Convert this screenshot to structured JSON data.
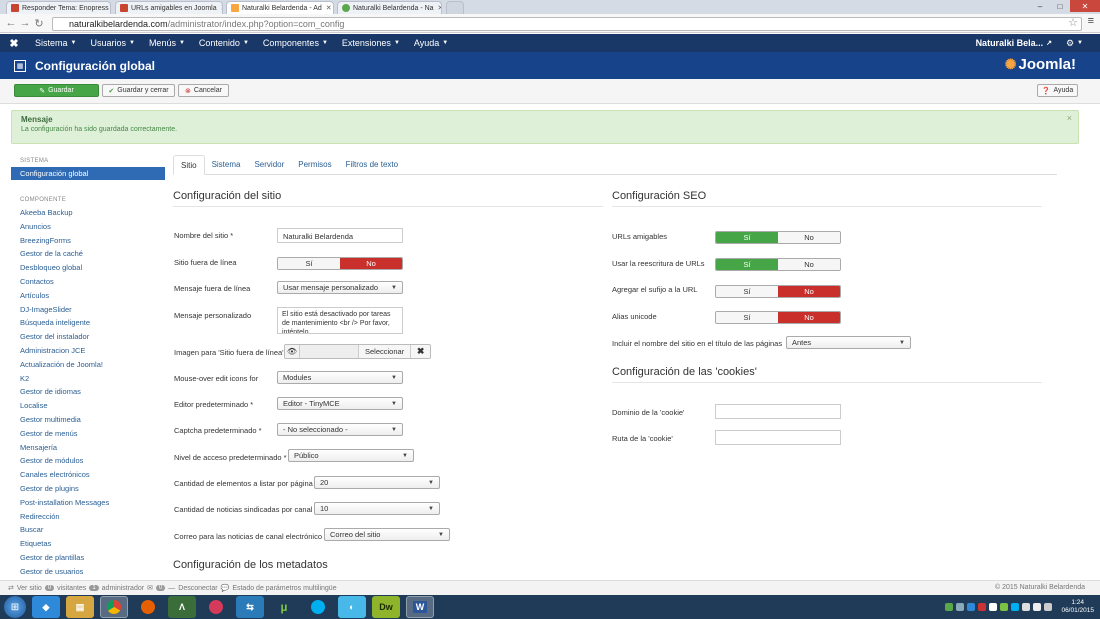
{
  "browser": {
    "tabs": [
      {
        "label": "Responder Tema: Enopress",
        "favicon_color": "#c8452f",
        "active": false
      },
      {
        "label": "URLs amigables en Joomla",
        "favicon_color": "#c8452f",
        "active": false
      },
      {
        "label": "Naturalki Belardenda - Ad",
        "favicon_color": "#f9a541",
        "active": true
      },
      {
        "label": "Naturalki Belardenda - Na",
        "favicon_color": "#5aa84a",
        "active": false
      }
    ],
    "url_host": "naturalkibelardenda.com",
    "url_path": "/administrator/index.php?option=com_config",
    "back_icon": "back-arrow-icon",
    "forward_icon": "forward-arrow-icon",
    "reload_icon": "reload-icon"
  },
  "nav": {
    "menu": [
      {
        "label": "Sistema"
      },
      {
        "label": "Usuarios"
      },
      {
        "label": "Menús"
      },
      {
        "label": "Contenido"
      },
      {
        "label": "Componentes"
      },
      {
        "label": "Extensiones"
      },
      {
        "label": "Ayuda"
      }
    ],
    "user_label": "Naturalki Bela...",
    "bg_color": "#1a3867"
  },
  "header": {
    "title": "Configuración global",
    "brand": "Joomla!",
    "bg_color": "#17438a"
  },
  "toolbar": {
    "save": "Guardar",
    "save_close": "Guardar y cerrar",
    "cancel": "Cancelar",
    "help": "Ayuda"
  },
  "message": {
    "heading": "Mensaje",
    "body": "La configuración ha sido guardada correctamente."
  },
  "sidebar": {
    "system_heading": "SISTEMA",
    "active_item": "Configuración global",
    "component_heading": "COMPONENTE",
    "items": [
      "Akeeba Backup",
      "Anuncios",
      "BreezingForms",
      "Gestor de la caché",
      "Desbloqueo global",
      "Contactos",
      "Artículos",
      "DJ-ImageSlider",
      "Búsqueda inteligente",
      "Gestor del instalador",
      "Administracion JCE",
      "Actualización de Joomla!",
      "K2",
      "Gestor de idiomas",
      "Localise",
      "Gestor multimedia",
      "Gestor de menús",
      "Mensajería",
      "Gestor de módulos",
      "Canales electrónicos",
      "Gestor de plugins",
      "Post-installation Messages",
      "Redirección",
      "Buscar",
      "Etiquetas",
      "Gestor de plantillas",
      "Gestor de usuarios"
    ]
  },
  "tabs": [
    "Sitio",
    "Sistema",
    "Servidor",
    "Permisos",
    "Filtros de texto"
  ],
  "site": {
    "title": "Configuración del sitio",
    "site_name_label": "Nombre del sitio *",
    "site_name_value": "Naturalki Belardenda",
    "offline_label": "Sitio fuera de línea",
    "offline_yes": "Sí",
    "offline_no": "No",
    "offline_msg_label": "Mensaje fuera de línea",
    "offline_msg_value": "Usar mensaje personalizado",
    "custom_msg_label": "Mensaje personalizado",
    "custom_msg_value": "El sitio está desactivado por tareas de mantenimiento <br /> Por favor, inténtelo",
    "offline_image_label": "Imagen para 'Sitio fuera de línea'",
    "select_label": "Seleccionar",
    "mouseover_label": "Mouse-over edit icons for",
    "mouseover_value": "Modules",
    "editor_label": "Editor predeterminado *",
    "editor_value": "Editor - TinyMCE",
    "captcha_label": "Captcha predeterminado *",
    "captcha_value": "- No seleccionado -",
    "access_label": "Nivel de acceso predeterminado *",
    "access_value": "Público",
    "list_limit_label": "Cantidad de elementos a listar por página",
    "list_limit_value": "20",
    "feed_limit_label": "Cantidad de noticias sindicadas por canal",
    "feed_limit_value": "10",
    "feed_email_label": "Correo para las noticias de canal electrónico",
    "feed_email_value": "Correo del sitio",
    "metadata_title": "Configuración de los metadatos"
  },
  "seo": {
    "title": "Configuración SEO",
    "sef_label": "URLs amigables",
    "rewrite_label": "Usar la reescritura de URLs",
    "suffix_label": "Agregar el sufijo a la URL",
    "unicode_label": "Alias unicode",
    "yes": "Sí",
    "no": "No",
    "sitename_label": "Incluir el nombre del sitio en el título de las páginas",
    "sitename_value": "Antes"
  },
  "cookies": {
    "title": "Configuración de las 'cookies'",
    "domain_label": "Dominio de la 'cookie'",
    "path_label": "Ruta de la 'cookie'"
  },
  "statusbar": {
    "view_site": "Ver sitio",
    "visitors_count": "0",
    "visitors_label": "visitantes",
    "admin_count": "1",
    "admin_label": "administrador",
    "messages_count": "0",
    "logout": "Desconectar",
    "multilang": "Estado de parámetros multilingüe",
    "copyright": "© 2015 Naturalki Belardenda"
  },
  "taskbar": {
    "time": "1:24",
    "date": "06/01/2015"
  },
  "colors": {
    "green": "#46a546",
    "red": "#c9302c",
    "link": "#2a5e93"
  }
}
